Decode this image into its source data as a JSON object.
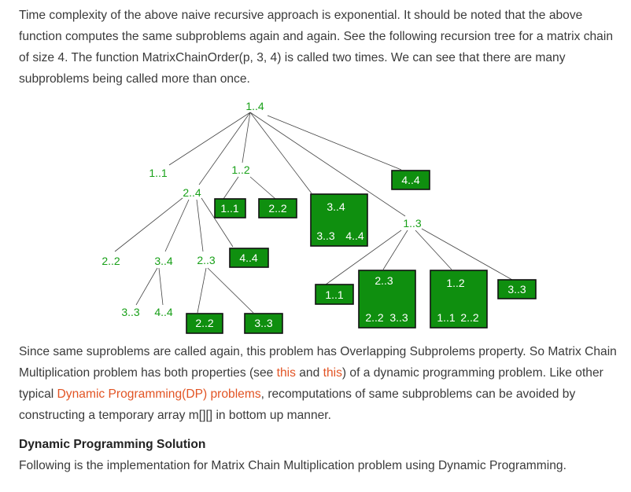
{
  "intro": {
    "text": "Time complexity of the above naive recursive approach is exponential. It should be noted that the above function computes the same subproblems again and again. See the following recursion tree for a matrix chain of size 4. The function MatrixChainOrder(p, 3, 4) is called two times. We can see that there are many subproblems being called more than once."
  },
  "tree": {
    "root": "1..4",
    "n_1_1_top": "1..1",
    "n_1_2": "1..2",
    "n_2_4": "2..4",
    "n_4_4_top": "4..4",
    "n_1_1_sub": "1..1",
    "n_2_2_sub": "2..2",
    "n_3_4_box": "3..4",
    "n_3_3_box": "3..3",
    "n_4_4_box": "4..4",
    "n_1_3": "1..3",
    "n_2_2_left": "2..2",
    "n_3_4_left": "3..4",
    "n_2_3_left": "2..3",
    "n_4_4_left": "4..4",
    "n_3_3_leaf": "3..3",
    "n_4_4_leaf": "4..4",
    "n_2_2_bot": "2..2",
    "n_3_3_bot": "3..3",
    "n_1_1_r": "1..1",
    "n_2_3_r": "2..3",
    "n_2_2_r": "2..2",
    "n_3_3_r": "3..3",
    "n_1_2_r": "1..2",
    "n_1_1_rr": "1..1",
    "n_2_2_rr": "2..2",
    "n_3_3_rr": "3..3"
  },
  "para2": {
    "text_a": "Since same suproblems are called again, this problem has Overlapping Subprolems property. So Matrix Chain Multiplication problem has both properties (see ",
    "link1": "this",
    "text_b": " and ",
    "link2": "this",
    "text_c": ") of a dynamic programming problem. Like other typical ",
    "link3": "Dynamic Programming(DP) problems",
    "text_d": ", recomputations of same subproblems can be avoided by constructing a temporary array m[][] in bottom up manner."
  },
  "section": {
    "heading": "Dynamic Programming Solution",
    "text": "Following is the implementation for Matrix Chain Multiplication problem using Dynamic Programming."
  }
}
